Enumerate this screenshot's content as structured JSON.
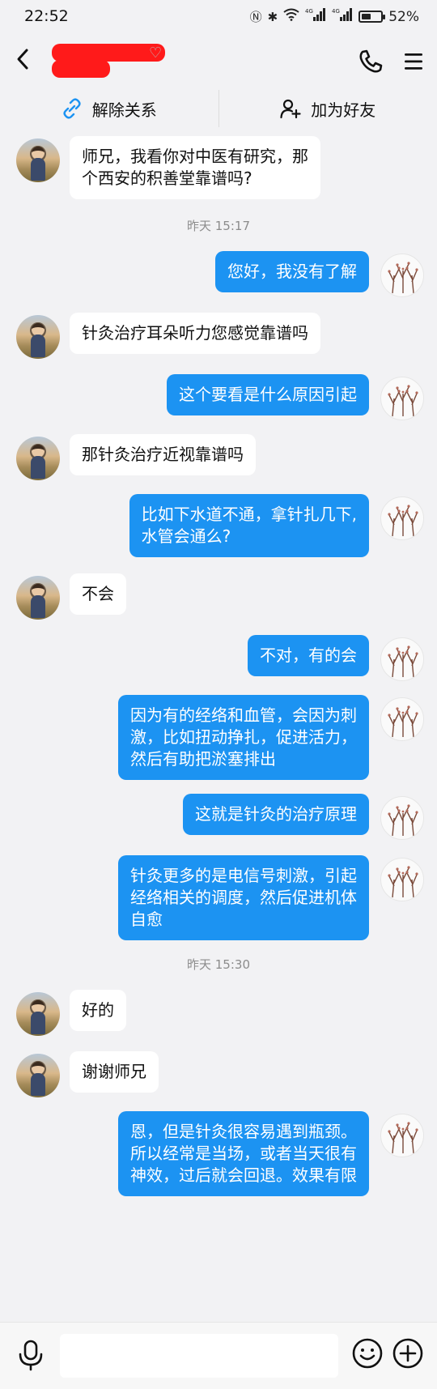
{
  "status_bar": {
    "time": "22:52",
    "network_left": "4G",
    "network_right": "4G",
    "battery": "52%",
    "battery_level": 0.52,
    "icons": [
      "nfc-icon",
      "bluetooth-icon",
      "wifi-icon",
      "signal-icon",
      "signal-icon",
      "battery-icon"
    ]
  },
  "header": {
    "contact_name": "",
    "back_icon": "chevron-left-icon",
    "call_icon": "phone-icon",
    "menu_icon": "menu-icon"
  },
  "actions": {
    "unlink_label": "解除关系",
    "unlink_icon": "link-broken-icon",
    "add_friend_label": "加为好友",
    "add_friend_icon": "user-plus-icon"
  },
  "messages": [
    {
      "type": "text",
      "side": "left",
      "text": "师兄，我看你对中医有研究，那\n个西安的积善堂靠谱吗?"
    },
    {
      "type": "time",
      "text": "昨天 15:17"
    },
    {
      "type": "text",
      "side": "right",
      "text": "您好，我没有了解"
    },
    {
      "type": "text",
      "side": "left",
      "text": "针灸治疗耳朵听力您感觉靠谱吗"
    },
    {
      "type": "text",
      "side": "right",
      "text": "这个要看是什么原因引起"
    },
    {
      "type": "text",
      "side": "left",
      "text": "那针灸治疗近视靠谱吗"
    },
    {
      "type": "text",
      "side": "right",
      "text": "比如下水道不通，拿针扎几下,\n水管会通么?"
    },
    {
      "type": "text",
      "side": "left",
      "text": "不会"
    },
    {
      "type": "text",
      "side": "right",
      "text": "不对，有的会"
    },
    {
      "type": "text",
      "side": "right",
      "text": "因为有的经络和血管，会因为刺\n激，比如扭动挣扎，促进活力，\n然后有助把淤塞排出"
    },
    {
      "type": "text",
      "side": "right",
      "text": "这就是针灸的治疗原理"
    },
    {
      "type": "text",
      "side": "right",
      "text": "针灸更多的是电信号刺激，引起\n经络相关的调度，然后促进机体\n自愈"
    },
    {
      "type": "time",
      "text": "昨天 15:30"
    },
    {
      "type": "text",
      "side": "left",
      "text": "好的"
    },
    {
      "type": "text",
      "side": "left",
      "text": "谢谢师兄"
    },
    {
      "type": "text",
      "side": "right",
      "text": "恩，但是针灸很容易遇到瓶颈。\n所以经常是当场，或者当天很有\n神效，过后就会回退。效果有限"
    }
  ],
  "input_bar": {
    "placeholder": "",
    "mic_icon": "microphone-icon",
    "emoji_icon": "emoji-icon",
    "plus_icon": "plus-circle-icon"
  },
  "colors": {
    "background": "#f2f2f4",
    "bubble_self": "#1c93f2",
    "bubble_other": "#ffffff",
    "name_redaction": "#ff1a1a"
  }
}
